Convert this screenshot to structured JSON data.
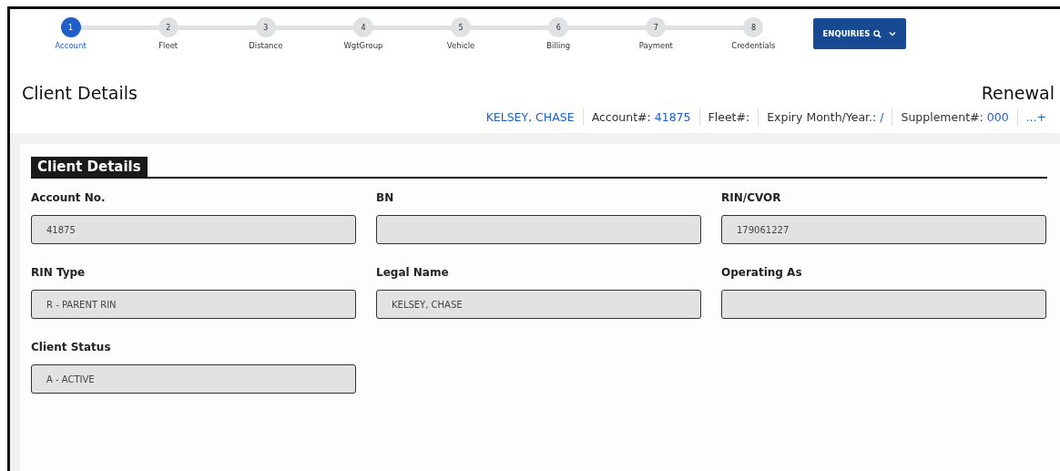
{
  "steps": [
    {
      "number": "1",
      "label": "Account",
      "selected": true
    },
    {
      "number": "2",
      "label": "Fleet",
      "selected": false
    },
    {
      "number": "3",
      "label": "Distance",
      "selected": false
    },
    {
      "number": "4",
      "label": "WgtGroup",
      "selected": false
    },
    {
      "number": "5",
      "label": "Vehicle",
      "selected": false
    },
    {
      "number": "6",
      "label": "Billing",
      "selected": false
    },
    {
      "number": "7",
      "label": "Payment",
      "selected": false
    },
    {
      "number": "8",
      "label": "Credentials",
      "selected": false
    }
  ],
  "enquiries_button": {
    "label": "ENQUIRIES"
  },
  "page_title": "Client Details",
  "mode": "Renewal",
  "summary": [
    {
      "value": "KELSEY, CHASE"
    },
    {
      "label": "Account#:",
      "value": "41875"
    },
    {
      "label": "Fleet#:"
    },
    {
      "label": "Expiry Month/Year.:",
      "value": "/"
    },
    {
      "label": "Supplement#:",
      "value": "000"
    },
    {
      "value": "...+"
    }
  ],
  "section": {
    "title": "Client Details",
    "fields": [
      {
        "label": "Account No.",
        "value": "41875",
        "disabled": true
      },
      {
        "label": "BN",
        "disabled": true
      },
      {
        "label": "RIN/CVOR",
        "value": "179061227",
        "disabled": true
      },
      {
        "label": "RIN Type",
        "value": "R - PARENT RIN",
        "disabled": true
      },
      {
        "label": "Legal Name",
        "value": "KELSEY, CHASE",
        "disabled": true
      },
      {
        "label": "Operating As",
        "disabled": true
      },
      {
        "label": "Client Status",
        "value": "A - ACTIVE",
        "disabled": true
      }
    ]
  }
}
